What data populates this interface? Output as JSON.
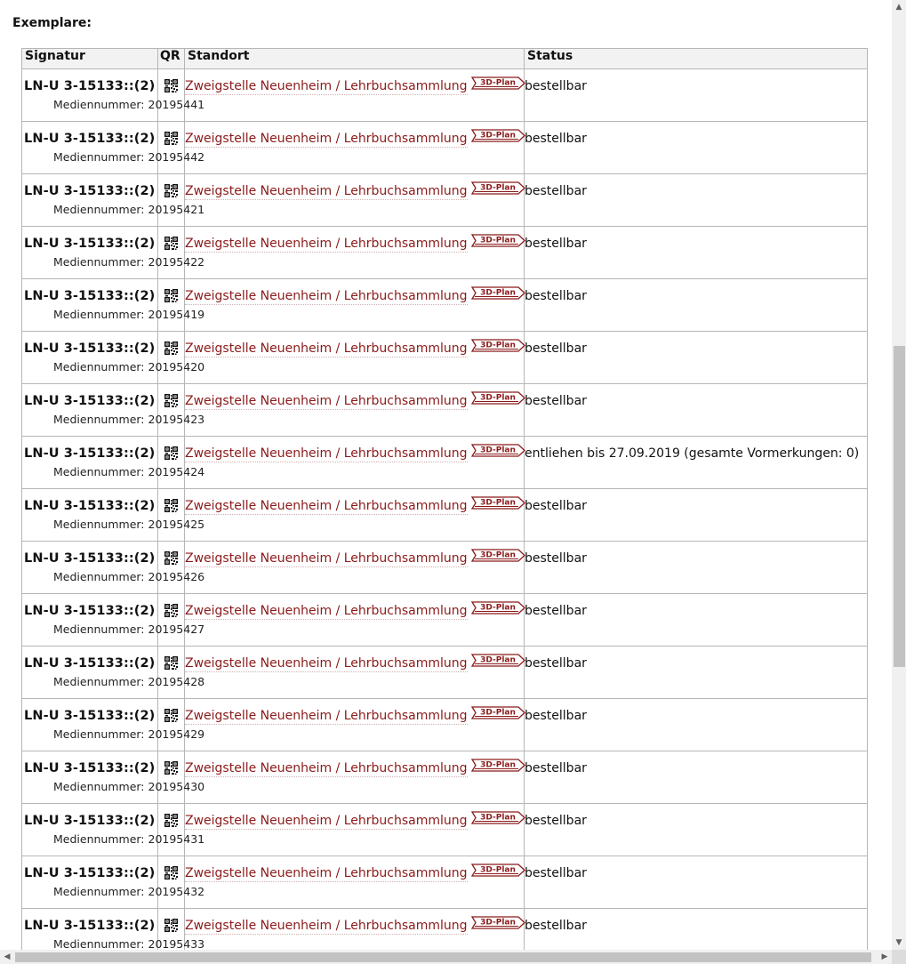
{
  "heading": "Exemplare:",
  "table": {
    "headers": {
      "signatur": "Signatur",
      "qr": "QR",
      "standort": "Standort",
      "status": "Status"
    },
    "location_label": "Zweigstelle Neuenheim / Lehrbuchsammlung",
    "plan_badge": "3D-Plan",
    "rows": [
      {
        "signatur": "LN-U 3-15133::(2)",
        "medium": "Mediennummer: 20195441",
        "status": "bestellbar"
      },
      {
        "signatur": "LN-U 3-15133::(2)",
        "medium": "Mediennummer: 20195442",
        "status": "bestellbar"
      },
      {
        "signatur": "LN-U 3-15133::(2)",
        "medium": "Mediennummer: 20195421",
        "status": "bestellbar"
      },
      {
        "signatur": "LN-U 3-15133::(2)",
        "medium": "Mediennummer: 20195422",
        "status": "bestellbar"
      },
      {
        "signatur": "LN-U 3-15133::(2)",
        "medium": "Mediennummer: 20195419",
        "status": "bestellbar"
      },
      {
        "signatur": "LN-U 3-15133::(2)",
        "medium": "Mediennummer: 20195420",
        "status": "bestellbar"
      },
      {
        "signatur": "LN-U 3-15133::(2)",
        "medium": "Mediennummer: 20195423",
        "status": "bestellbar"
      },
      {
        "signatur": "LN-U 3-15133::(2)",
        "medium": "Mediennummer: 20195424",
        "status": "entliehen bis 27.09.2019 (gesamte Vormerkungen: 0)"
      },
      {
        "signatur": "LN-U 3-15133::(2)",
        "medium": "Mediennummer: 20195425",
        "status": "bestellbar"
      },
      {
        "signatur": "LN-U 3-15133::(2)",
        "medium": "Mediennummer: 20195426",
        "status": "bestellbar"
      },
      {
        "signatur": "LN-U 3-15133::(2)",
        "medium": "Mediennummer: 20195427",
        "status": "bestellbar"
      },
      {
        "signatur": "LN-U 3-15133::(2)",
        "medium": "Mediennummer: 20195428",
        "status": "bestellbar"
      },
      {
        "signatur": "LN-U 3-15133::(2)",
        "medium": "Mediennummer: 20195429",
        "status": "bestellbar"
      },
      {
        "signatur": "LN-U 3-15133::(2)",
        "medium": "Mediennummer: 20195430",
        "status": "bestellbar"
      },
      {
        "signatur": "LN-U 3-15133::(2)",
        "medium": "Mediennummer: 20195431",
        "status": "bestellbar"
      },
      {
        "signatur": "LN-U 3-15133::(2)",
        "medium": "Mediennummer: 20195432",
        "status": "bestellbar"
      },
      {
        "signatur": "LN-U 3-15133::(2)",
        "medium": "Mediennummer: 20195433",
        "status": "bestellbar"
      }
    ]
  },
  "colors": {
    "link": "#8b1a1a",
    "border": "#b6b6b6"
  },
  "icons": {
    "qr": "qr-code-icon",
    "plan": "3d-plan-icon"
  }
}
